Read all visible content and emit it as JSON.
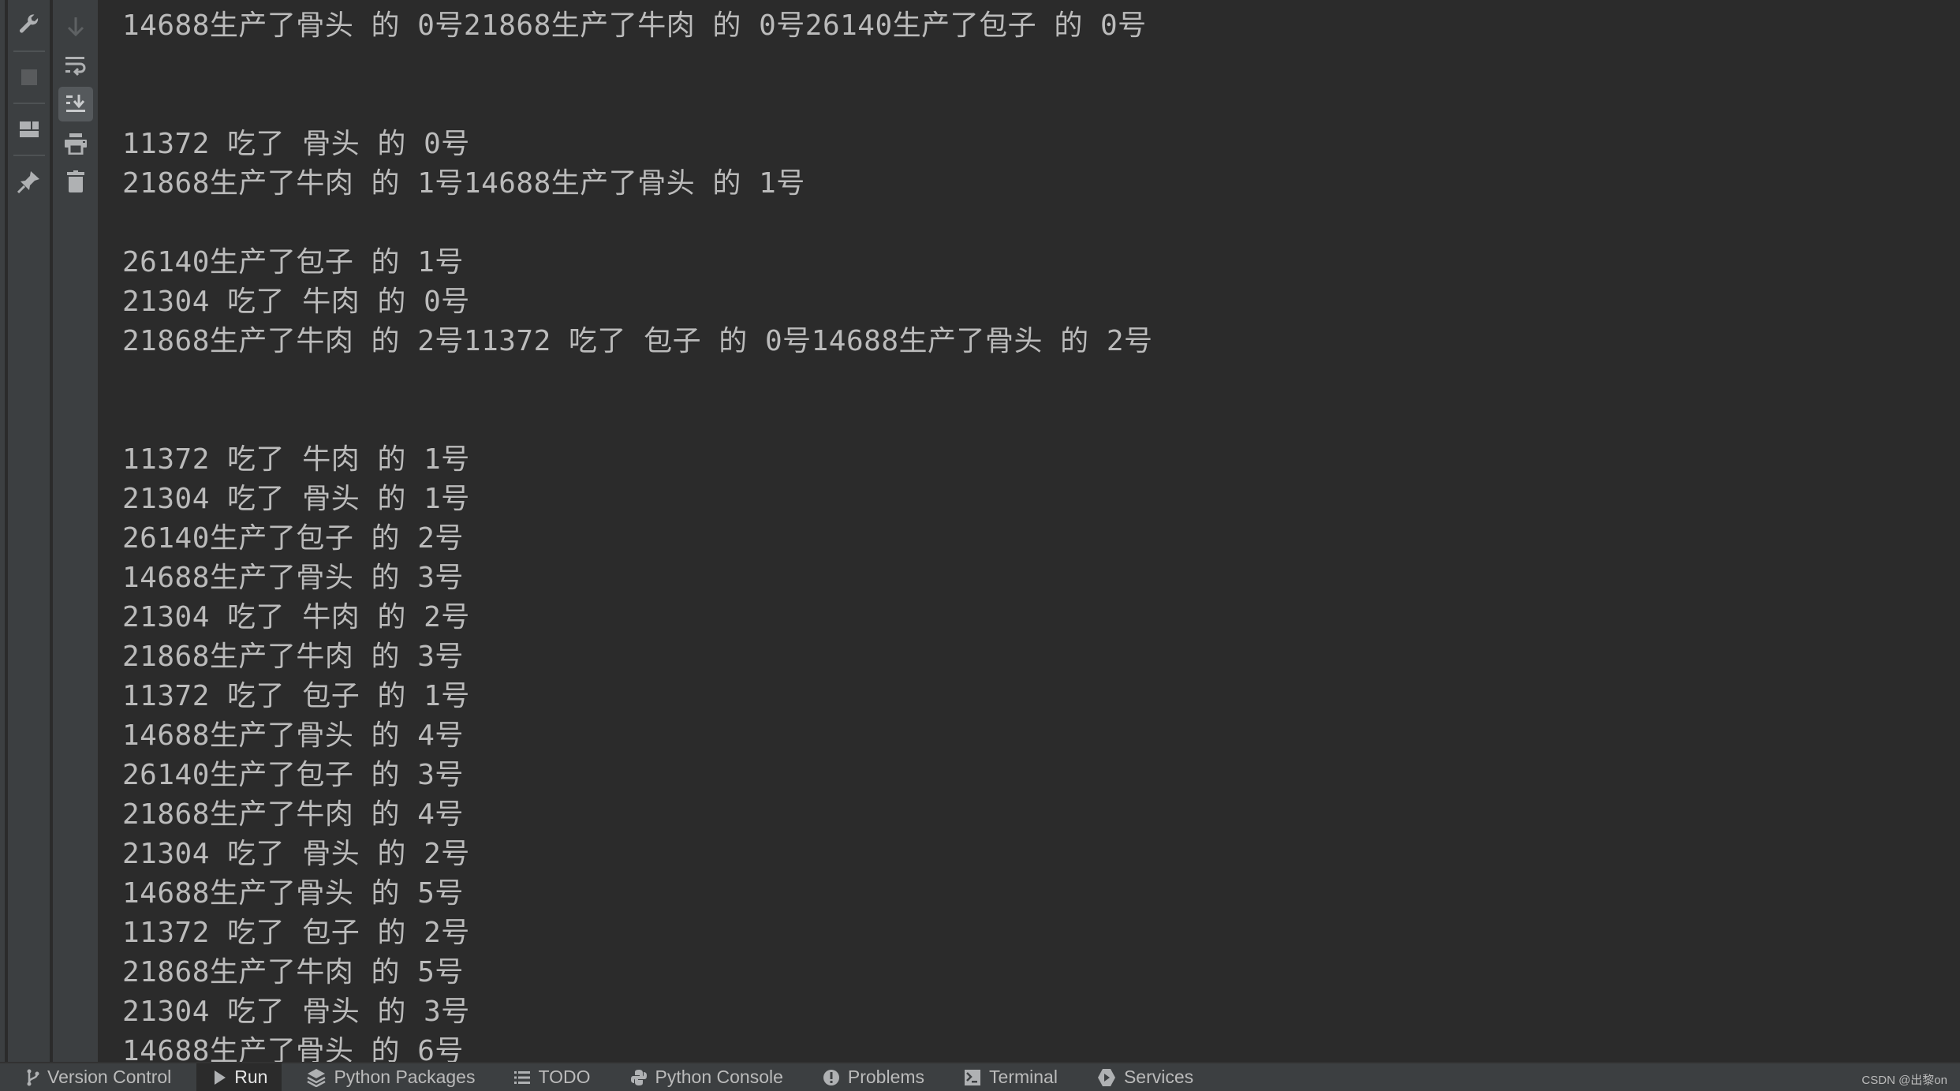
{
  "toolbar_left": {
    "items": [
      {
        "icon": "wrench-icon",
        "label": "Settings"
      },
      {
        "icon": "stop-icon",
        "label": "Stop"
      },
      {
        "icon": "layout-icon",
        "label": "Layout"
      },
      {
        "icon": "pin-icon",
        "label": "Pin Tab"
      }
    ]
  },
  "toolbar_right": {
    "items": [
      {
        "icon": "arrow-down-icon",
        "label": "Down"
      },
      {
        "icon": "soft-wrap-icon",
        "label": "Soft-Wrap"
      },
      {
        "icon": "scroll-to-end-icon",
        "label": "Scroll to End",
        "active": true
      },
      {
        "icon": "print-icon",
        "label": "Print"
      },
      {
        "icon": "trash-icon",
        "label": "Clear All"
      }
    ]
  },
  "console": {
    "lines": [
      "14688生产了骨头 的 0号21868生产了牛肉 的 0号26140生产了包子 的 0号",
      "",
      "",
      "11372 吃了 骨头 的 0号",
      "21868生产了牛肉 的 1号14688生产了骨头 的 1号",
      "",
      "26140生产了包子 的 1号",
      "21304 吃了 牛肉 的 0号",
      "21868生产了牛肉 的 2号11372 吃了 包子 的 0号14688生产了骨头 的 2号",
      "",
      "",
      "11372 吃了 牛肉 的 1号",
      "21304 吃了 骨头 的 1号",
      "26140生产了包子 的 2号",
      "14688生产了骨头 的 3号",
      "21304 吃了 牛肉 的 2号",
      "21868生产了牛肉 的 3号",
      "11372 吃了 包子 的 1号",
      "14688生产了骨头 的 4号",
      "26140生产了包子 的 3号",
      "21868生产了牛肉 的 4号",
      "21304 吃了 骨头 的 2号",
      "14688生产了骨头 的 5号",
      "11372 吃了 包子 的 2号",
      "21868生产了牛肉 的 5号",
      "21304 吃了 骨头 的 3号",
      "14688生产了骨头 的 6号"
    ]
  },
  "bottom_bar": {
    "tabs": [
      {
        "label": "Version Control",
        "icon": "branch-icon"
      },
      {
        "label": "Run",
        "icon": "play-icon",
        "active": true
      },
      {
        "label": "Python Packages",
        "icon": "layers-icon"
      },
      {
        "label": "TODO",
        "icon": "list-icon"
      },
      {
        "label": "Python Console",
        "icon": "python-icon"
      },
      {
        "label": "Problems",
        "icon": "warning-icon"
      },
      {
        "label": "Terminal",
        "icon": "terminal-icon"
      },
      {
        "label": "Services",
        "icon": "services-icon"
      }
    ],
    "watermark": "CSDN @出黎on"
  },
  "colors": {
    "console_bg": "#2b2b2b",
    "panel_bg": "#3c3f41",
    "text": "#bbbbbb",
    "active_tab_bg": "#2b2b2b"
  }
}
